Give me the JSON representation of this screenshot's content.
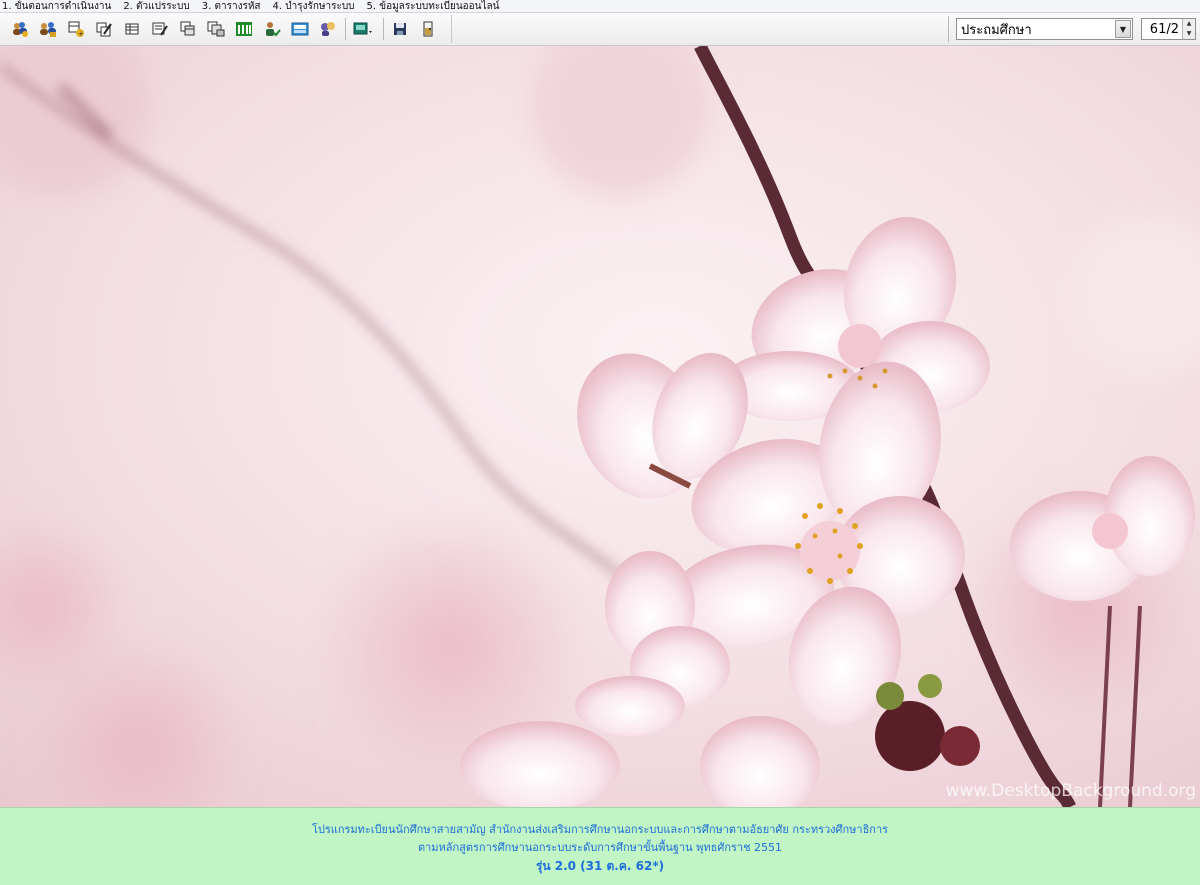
{
  "menu": {
    "items": [
      "1. ขั้นตอนการดำเนินงาน",
      "2. ตัวแปรระบบ",
      "3. ตารางรหัส",
      "4. บำรุงรักษาระบบ",
      "5. ข้อมูลระบบทะเบียนออนไลน์"
    ]
  },
  "toolbar": {
    "icons": [
      "users-add-icon",
      "users-group-icon",
      "table-add-icon",
      "records-edit-icon",
      "grid-icon",
      "form-edit-icon",
      "copy-icon",
      "multi-copy-icon",
      "column-chart-icon",
      "user-check-icon",
      "certificate-icon",
      "people-chat-icon",
      "screen-dropdown-icon",
      "save-icon",
      "exit-icon"
    ],
    "level_value": "ประถมศึกษา",
    "term_value": "61/2"
  },
  "wallpaper": {
    "watermark": "www.DesktopBackground.org"
  },
  "footer": {
    "line1": "โปรแกรมทะเบียนนักศึกษาสายสามัญ สำนักงานส่งเสริมการศึกษานอกระบบและการศึกษาตามอัธยาศัย กระทรวงศึกษาธิการ",
    "line2": "ตามหลักสูตรการศึกษานอกระบบระดับการศึกษาขั้นพื้นฐาน พุทธศักราช 2551",
    "version": "รุ่น 2.0 (31 ต.ค. 62*)"
  },
  "colors": {
    "footer_bg": "#c2f5c5",
    "footer_text": "#1c6fd9",
    "wallpaper_base": "#f3e3e6"
  }
}
